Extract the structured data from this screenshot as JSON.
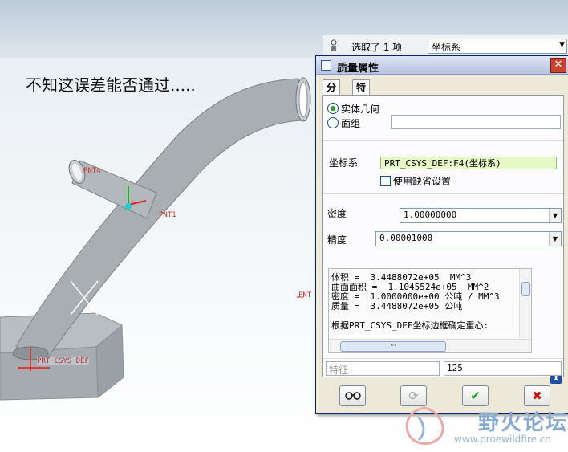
{
  "caption": "不知这误差能否通过.....",
  "selection": {
    "text": "选取了 1 项",
    "filter_value": "坐标系"
  },
  "model_tags": {
    "pnt4": "PNT4",
    "pnt1": "PNT1",
    "pnt_right": "PNT",
    "csys": "PRT_CSYS_DEF"
  },
  "dialog": {
    "title": "质量属性",
    "close_label": "✕",
    "tabs": [
      "分析",
      "特征"
    ],
    "radio_solid": "实体几何",
    "radio_quilt": "面组",
    "quilt_value": "",
    "csys_label": "坐标系",
    "csys_value": "PRT_CSYS_DEF:F4(坐标系)",
    "use_default_label": "使用缺省设置",
    "density_label": "密度",
    "density_value": "1.00000000",
    "accuracy_label": "精度",
    "accuracy_value": "0.00001000",
    "results": [
      "体积 =  3.4488072e+05  MM^3",
      "曲面面积 =  1.1045524e+05  MM^2",
      "密度 =  1.0000000e+00 公吨 / MM^3",
      "质量 =  3.4488072e+05 公吨",
      "",
      "根据PRT_CSYS_DEF坐标边框确定重心:"
    ],
    "feature_placeholder": "特征",
    "feature_number": "125"
  },
  "watermark": {
    "name": "野火论坛",
    "url": "www.proewildfire.cn"
  }
}
